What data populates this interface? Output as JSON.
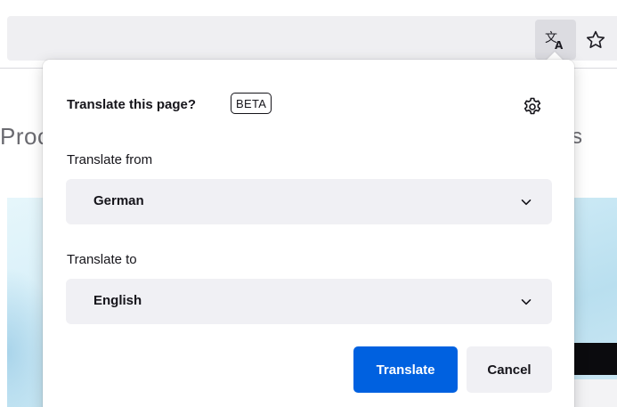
{
  "toolbar": {
    "translate_icon": "translate-icon",
    "bookmark_icon": "star-outline-icon"
  },
  "page_behind": {
    "left_fragment": "Proc",
    "right_fragment": "s"
  },
  "panel": {
    "title": "Translate this page?",
    "badge": "BETA",
    "settings_icon": "gear-icon",
    "from_label": "Translate from",
    "from_value": "German",
    "to_label": "Translate to",
    "to_value": "English",
    "chevron_icon": "chevron-down-icon",
    "translate_button": "Translate",
    "cancel_button": "Cancel"
  },
  "colors": {
    "primary_button": "#0061e0",
    "secondary_button": "#f0f0f4",
    "select_bg": "#f0f0f4",
    "text": "#15141a"
  }
}
